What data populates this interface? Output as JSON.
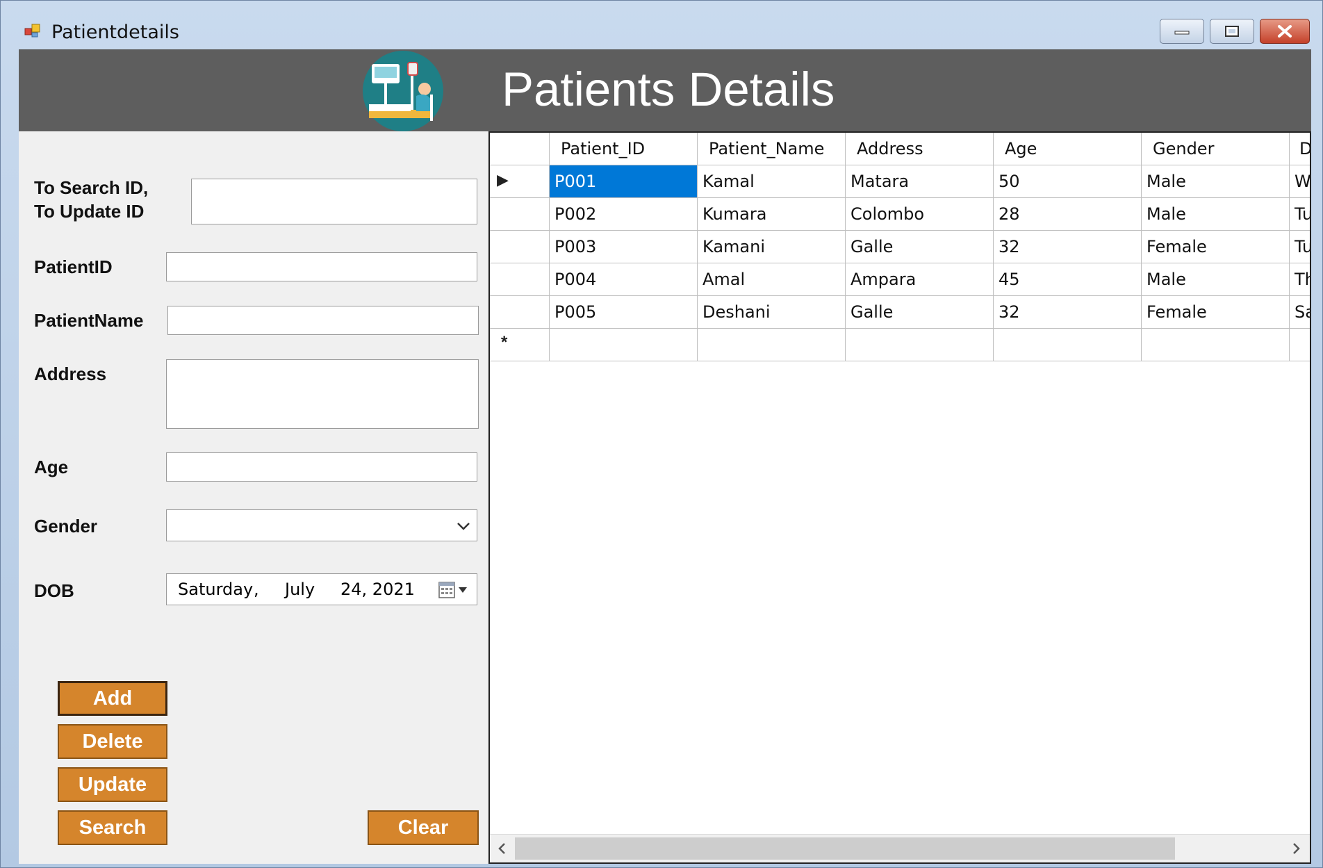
{
  "window": {
    "title": "Patientdetails"
  },
  "header": {
    "title": "Patients Details",
    "logo_icon": "hospital-patient-icon"
  },
  "form": {
    "search_label_line1": "To Search ID,",
    "search_label_line2": "To Update ID",
    "search_value": "",
    "patient_id_label": "PatientID",
    "patient_id_value": "",
    "patient_name_label": "PatientName",
    "patient_name_value": "",
    "address_label": "Address",
    "address_value": "",
    "age_label": "Age",
    "age_value": "",
    "gender_label": "Gender",
    "gender_value": "",
    "dob_label": "DOB",
    "dob": {
      "weekday": "Saturday",
      "sep": ",",
      "month": "July",
      "day_year": "24, 2021"
    }
  },
  "buttons": {
    "add": "Add",
    "delete": "Delete",
    "update": "Update",
    "search": "Search",
    "clear": "Clear"
  },
  "colors": {
    "button": "#d5852c",
    "header": "#5e5e5e",
    "selection": "#0078d7"
  },
  "grid": {
    "columns": [
      "Patient_ID",
      "Patient_Name",
      "Address",
      "Age",
      "Gender",
      "D"
    ],
    "rows": [
      {
        "cells": [
          "P001",
          "Kamal",
          "Matara",
          "50",
          "Male",
          "W"
        ]
      },
      {
        "cells": [
          "P002",
          "Kumara",
          "Colombo",
          "28",
          "Male",
          "Tu"
        ]
      },
      {
        "cells": [
          "P003",
          "Kamani",
          "Galle",
          "32",
          "Female",
          "Tu"
        ]
      },
      {
        "cells": [
          "P004",
          "Amal",
          "Ampara",
          "45",
          "Male",
          "Th"
        ]
      },
      {
        "cells": [
          "P005",
          "Deshani",
          "Galle",
          "32",
          "Female",
          "Sa"
        ]
      }
    ],
    "current_row_marker": "▶",
    "new_row_marker": "*",
    "selected_cell": "P001"
  }
}
